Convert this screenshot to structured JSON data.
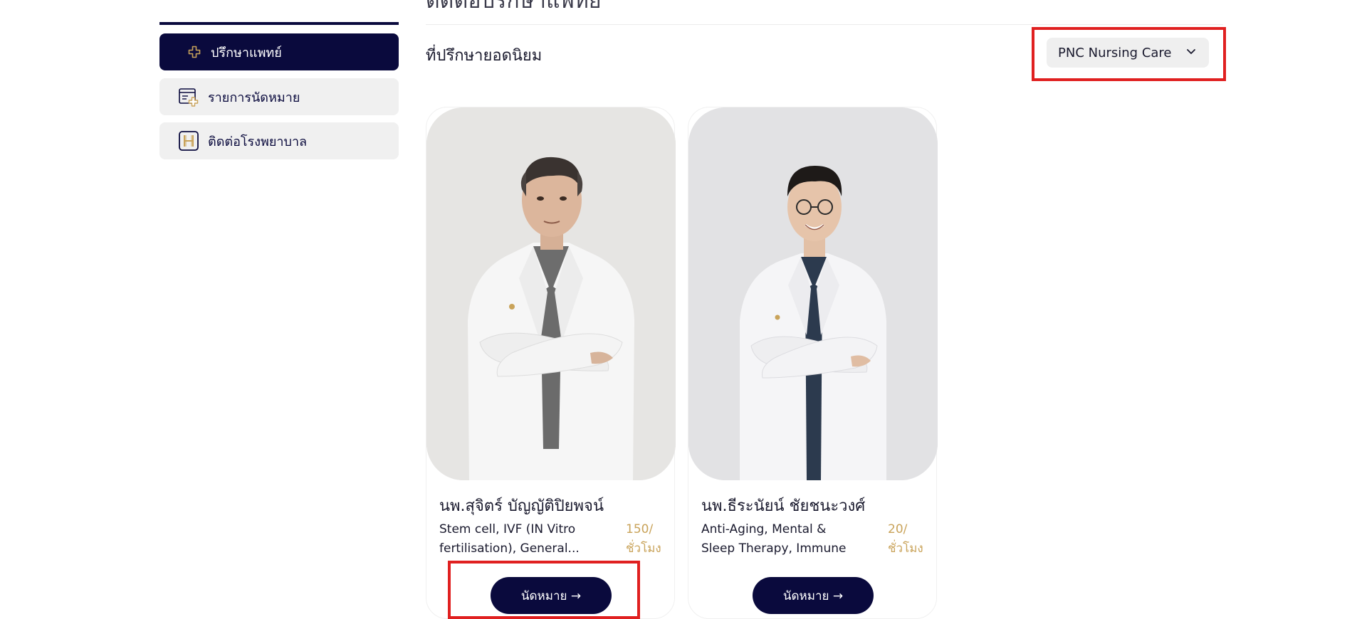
{
  "page": {
    "title": "ติดต่อปรึกษาแพทย์"
  },
  "sidebar": {
    "items": [
      {
        "label": "ปรึกษาแพทย์",
        "icon": "plus-cross-icon",
        "active": true
      },
      {
        "label": "รายการนัดหมาย",
        "icon": "calendar-plus-icon",
        "active": false
      },
      {
        "label": "ติดต่อโรงพยาบาล",
        "icon": "hospital-icon",
        "active": false
      }
    ]
  },
  "main": {
    "section_title": "ที่ปรึกษายอดนิยม",
    "hospital_select": {
      "value": "PNC Nursing Care"
    },
    "doctors": [
      {
        "name": "นพ.สุจิตร์ บัญญัติปิยพจน์",
        "specialties": "Stem cell, IVF (IN Vitro fertilisation), General...",
        "price": "150/",
        "price_unit": "ชั่วโมง",
        "button_label": "นัดหมาย →"
      },
      {
        "name": "นพ.ธีระนัยน์ ชัยชนะวงศ์",
        "specialties": "Anti-Aging, Mental & Sleep Therapy, Immune therapy,...",
        "price": "20/",
        "price_unit": "ชั่วโมง",
        "button_label": "นัดหมาย →"
      }
    ]
  },
  "colors": {
    "navy": "#0a0a3d",
    "gold": "#c9a35a",
    "highlight": "#e02020",
    "sidebar_bg": "#f0f0f0"
  }
}
